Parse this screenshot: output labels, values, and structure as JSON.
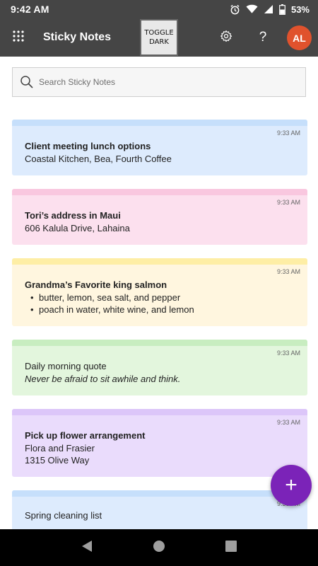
{
  "status_bar": {
    "time": "9:42 AM",
    "battery_percent": "53%",
    "icons": [
      "alarm-icon",
      "wifi-icon",
      "signal-icon",
      "battery-icon"
    ]
  },
  "app_bar": {
    "title": "Sticky Notes",
    "toggle_dark_label": "TOGGLE DARK",
    "help_label": "?",
    "avatar_initials": "AL",
    "avatar_color": "#e0522d",
    "background_color": "#454545"
  },
  "search": {
    "placeholder": "Search Sticky Notes",
    "value": ""
  },
  "notes": [
    {
      "color": "blue",
      "time": "9:33 AM",
      "title": "Client meeting lunch options",
      "lines": [
        "Coastal Kitchen, Bea, Fourth Coffee"
      ]
    },
    {
      "color": "pink",
      "time": "9:33 AM",
      "title": "Tori’s address in Maui",
      "lines": [
        "606 Kalula Drive, Lahaina"
      ]
    },
    {
      "color": "yellow",
      "time": "9:33 AM",
      "title": "Grandma’s Favorite king salmon",
      "bullets": [
        "butter, lemon, sea salt, and pepper",
        "poach in water, white wine, and lemon"
      ]
    },
    {
      "color": "green",
      "time": "9:33 AM",
      "plain": "Daily morning quote",
      "italic": "Never be afraid to sit awhile and think."
    },
    {
      "color": "purple",
      "time": "9:33 AM",
      "title": "Pick up flower arrangement",
      "lines": [
        "Flora and Frasier",
        "1315 Olive Way"
      ]
    },
    {
      "color": "blue",
      "time": "9:33 AM",
      "plain": "Spring cleaning list"
    }
  ],
  "fab": {
    "label": "+",
    "color": "#7b23b8"
  },
  "nav_bar": {
    "buttons": [
      "back-icon",
      "home-icon",
      "recents-icon"
    ]
  }
}
